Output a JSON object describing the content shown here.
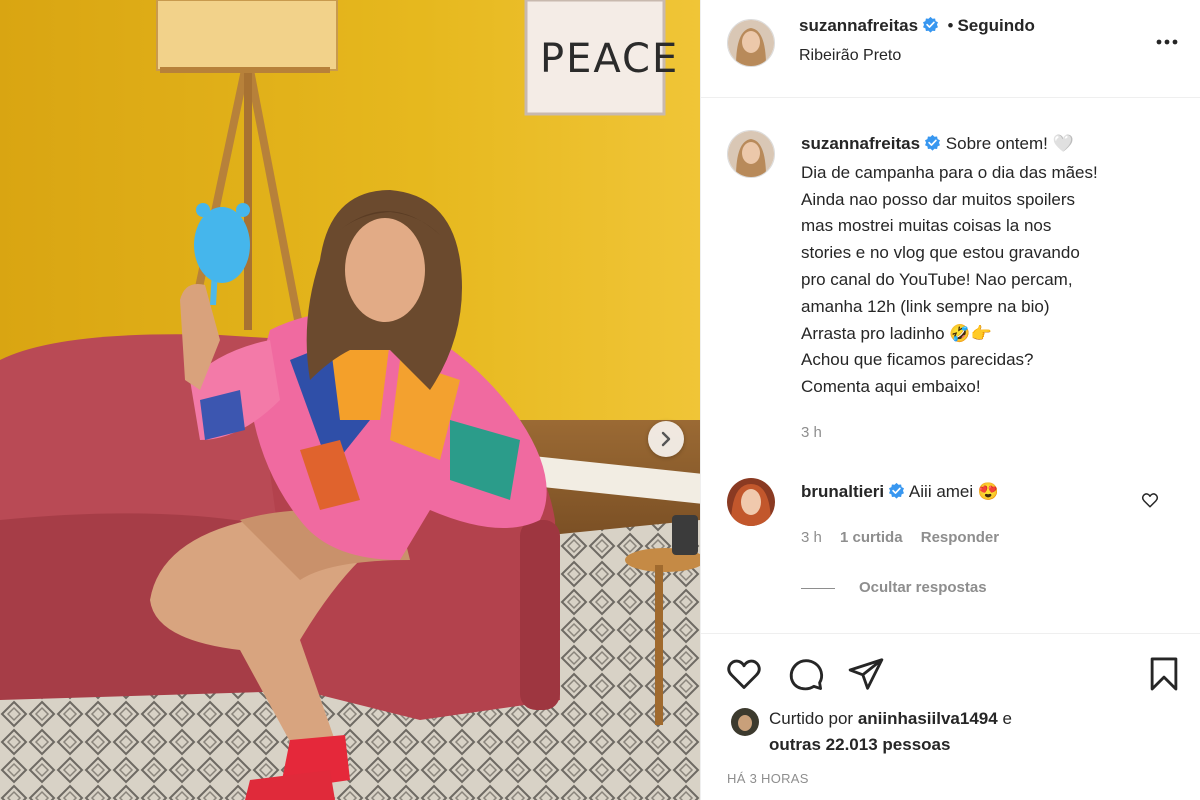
{
  "post": {
    "author": "suzannafreitas",
    "separator": "•",
    "follow_status": "Seguindo",
    "location": "Ribeirão Preto",
    "caption_lines": [
      "Sobre ontem! 🤍",
      "Dia de campanha para o dia das mães!",
      "Ainda nao posso dar muitos spoilers",
      "mas mostrei muitas coisas la nos",
      "stories e no vlog que estou gravando",
      "pro canal do YouTube! Nao percam,",
      "amanha 12h (link sempre na bio)",
      "Arrasta pro ladinho 🤣👉",
      "Achou que ficamos parecidas?",
      "Comenta aqui embaixo!"
    ],
    "caption_time": "3 h",
    "photo_sign_text": "PEACE"
  },
  "comment": {
    "author": "brunaltieri",
    "text": "Aiii amei 😍",
    "time": "3 h",
    "likes": "1 curtida",
    "reply": "Responder",
    "hide_replies": "Ocultar respostas"
  },
  "likes": {
    "prefix": "Curtido por",
    "user": "aniinhasiilva1494",
    "conj": "e",
    "others": "outras 22.013 pessoas"
  },
  "timestamp": "HÁ 3 HORAS",
  "icons": {
    "more": "more-options-icon",
    "like": "heart-icon",
    "comment": "comment-icon",
    "share": "share-icon",
    "save": "bookmark-icon",
    "verified": "verified-badge-icon",
    "next": "chevron-right-icon"
  },
  "colors": {
    "verified": "#3897f0",
    "wall": "#e4b51c",
    "sofa": "#b7434d"
  }
}
